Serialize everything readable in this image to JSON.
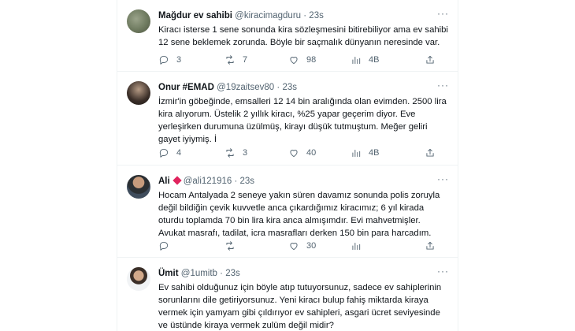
{
  "tweets": [
    {
      "name": "Mağdur ev sahibi",
      "handle": "@kiracimagduru",
      "time": "23s",
      "text": "Kiracı isterse 1 sene sonunda kira sözleşmesini bitirebiliyor ama ev sahibi 12 sene beklemek zorunda. Böyle bir saçmalık dünyanın neresinde var.",
      "replies": "3",
      "retweets": "7",
      "likes": "98",
      "views": "4B"
    },
    {
      "name": "Onur #EMAD",
      "handle": "@19zaitsev80",
      "time": "23s",
      "text": "İzmir'in göbeğinde, emsalleri 12 14 bin aralığında olan evimden. 2500 lira kira alıyorum. Üstelik 2 yıllık kiracı, %25 yapar geçerim diyor. Eve yerleşirken durumuna üzülmüş, kirayı düşük tutmuştum. Meğer geliri gayet iyiymiş. İ",
      "replies": "4",
      "retweets": "3",
      "likes": "40",
      "views": "4B"
    },
    {
      "name": "Ali",
      "handle": "@ali121916",
      "time": "23s",
      "text": "Hocam Antalyada 2 seneye yakın süren davamız sonunda polis zoruyla değil bildiğin çevik kuvvetle anca çıkardığımız kiracımız; 6 yıl kirada oturdu toplamda 70 bin lira kira anca almışımdır. Evi mahvetmişler. Avukat masrafı, tadilat, icra masrafları derken 150 bin para harcadım.",
      "replies": "",
      "retweets": "",
      "likes": "30",
      "views": ""
    },
    {
      "name": "Ümit",
      "handle": "@1umitb",
      "time": "23s",
      "text": "Ev sahibi olduğunuz için böyle atıp tutuyorsunuz,  sadece ev sahiplerinin sorunlarını dile getiriyorsunuz. Yeni kiracı bulup fahiş miktarda kiraya vermek için yamyam gibi çıldırıyor ev sahipleri, asgari ücret seviyesinde ve üstünde kiraya vermek zulüm değil midir?",
      "replies": "",
      "retweets": "",
      "likes": "",
      "views": ""
    }
  ],
  "colors": {
    "text": "#0f1419",
    "secondary": "#536471",
    "border": "#eff3f4",
    "badge": "#e0245e"
  },
  "icons": [
    "reply-icon",
    "retweet-icon",
    "like-icon",
    "views-icon",
    "share-icon",
    "more-icon"
  ]
}
